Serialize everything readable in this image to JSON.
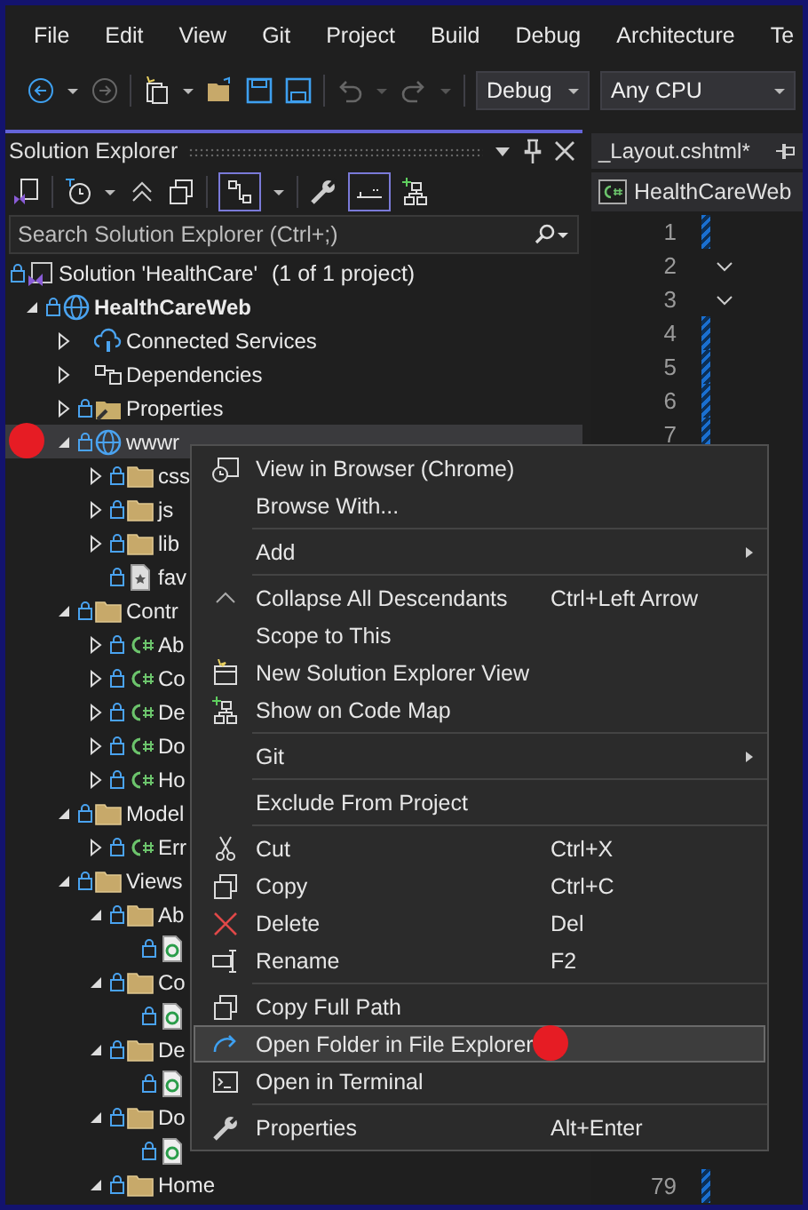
{
  "menu_bar": {
    "items": [
      "File",
      "Edit",
      "View",
      "Git",
      "Project",
      "Build",
      "Debug",
      "Architecture",
      "Te"
    ]
  },
  "toolbar": {
    "configuration": "Debug",
    "platform": "Any CPU"
  },
  "solution_explorer": {
    "title": "Solution Explorer",
    "search": {
      "placeholder": "Search Solution Explorer (Ctrl+;)"
    },
    "tree": [
      {
        "label": "Solution 'HealthCare'",
        "note": "(1 of 1 project)",
        "kind": "solution",
        "locked": true,
        "children": [
          {
            "label": "HealthCareWeb",
            "kind": "project",
            "locked": true,
            "bold": true,
            "expanded": true,
            "children": [
              {
                "label": "Connected Services",
                "kind": "connected",
                "locked": false,
                "expanded": false
              },
              {
                "label": "Dependencies",
                "kind": "dependencies",
                "locked": false,
                "expanded": false
              },
              {
                "label": "Properties",
                "kind": "properties",
                "locked": true,
                "expanded": false
              },
              {
                "label": "wwwr",
                "kind": "web",
                "locked": true,
                "expanded": true,
                "selected": true,
                "marker": true,
                "children": [
                  {
                    "label": "css",
                    "kind": "folder",
                    "locked": true,
                    "expanded": false
                  },
                  {
                    "label": "js",
                    "kind": "folder",
                    "locked": true,
                    "expanded": false
                  },
                  {
                    "label": "lib",
                    "kind": "folder",
                    "locked": true,
                    "expanded": false
                  },
                  {
                    "label": "fav",
                    "kind": "file",
                    "locked": true
                  }
                ]
              },
              {
                "label": "Contr",
                "kind": "folder",
                "locked": true,
                "expanded": true,
                "children": [
                  {
                    "label": "Ab",
                    "kind": "csharp",
                    "locked": true,
                    "expanded": false
                  },
                  {
                    "label": "Co",
                    "kind": "csharp",
                    "locked": true,
                    "expanded": false
                  },
                  {
                    "label": "De",
                    "kind": "csharp",
                    "locked": true,
                    "expanded": false
                  },
                  {
                    "label": "Do",
                    "kind": "csharp",
                    "locked": true,
                    "expanded": false
                  },
                  {
                    "label": "Ho",
                    "kind": "csharp",
                    "locked": true,
                    "expanded": false
                  }
                ]
              },
              {
                "label": "Model",
                "kind": "folder",
                "locked": true,
                "expanded": true,
                "children": [
                  {
                    "label": "Err",
                    "kind": "csharp",
                    "locked": true,
                    "expanded": false
                  }
                ]
              },
              {
                "label": "Views",
                "kind": "folder",
                "locked": true,
                "expanded": true,
                "children": [
                  {
                    "label": "Ab",
                    "kind": "folder",
                    "locked": true,
                    "expanded": true,
                    "children": [
                      {
                        "kind": "razor",
                        "locked": true
                      }
                    ]
                  },
                  {
                    "label": "Co",
                    "kind": "folder",
                    "locked": true,
                    "expanded": true,
                    "children": [
                      {
                        "kind": "razor",
                        "locked": true
                      }
                    ]
                  },
                  {
                    "label": "De",
                    "kind": "folder",
                    "locked": true,
                    "expanded": true,
                    "children": [
                      {
                        "kind": "razor",
                        "locked": true
                      }
                    ]
                  },
                  {
                    "label": "Do",
                    "kind": "folder",
                    "locked": true,
                    "expanded": true,
                    "children": [
                      {
                        "kind": "razor",
                        "locked": true
                      }
                    ]
                  },
                  {
                    "label": "Home",
                    "kind": "folder",
                    "locked": true,
                    "expanded": true
                  }
                ]
              }
            ]
          }
        ]
      }
    ]
  },
  "editor": {
    "tab": {
      "label": "_Layout.cshtml*"
    },
    "navigation": "HealthCareWeb",
    "lines_top": [
      {
        "number": "1",
        "fold": false,
        "changed": true
      },
      {
        "number": "2",
        "fold": true,
        "changed": false
      },
      {
        "number": "3",
        "fold": true,
        "changed": false
      },
      {
        "number": "4",
        "fold": false,
        "changed": true
      },
      {
        "number": "5",
        "fold": false,
        "changed": true
      },
      {
        "number": "6",
        "fold": false,
        "changed": true
      },
      {
        "number": "7",
        "fold": false,
        "changed": true
      }
    ],
    "lines_bottom": [
      {
        "number": "79",
        "fold": false,
        "changed": true
      }
    ]
  },
  "context_menu": {
    "groups": [
      [
        {
          "kind": "browser",
          "label": "View in Browser (Chrome)"
        },
        {
          "label": "Browse With..."
        }
      ],
      [
        {
          "label": "Add",
          "submenu": true
        }
      ],
      [
        {
          "kind": "collapse",
          "label": "Collapse All Descendants",
          "shortcut": "Ctrl+Left Arrow"
        },
        {
          "label": "Scope to This"
        },
        {
          "kind": "new-view",
          "label": "New Solution Explorer View"
        },
        {
          "kind": "code-map",
          "label": "Show on Code Map"
        }
      ],
      [
        {
          "label": "Git",
          "submenu": true
        }
      ],
      [
        {
          "label": "Exclude From Project"
        }
      ],
      [
        {
          "kind": "cut",
          "label": "Cut",
          "shortcut": "Ctrl+X"
        },
        {
          "kind": "copy",
          "label": "Copy",
          "shortcut": "Ctrl+C"
        },
        {
          "kind": "delete",
          "label": "Delete",
          "shortcut": "Del"
        },
        {
          "kind": "rename",
          "label": "Rename",
          "shortcut": "F2"
        }
      ],
      [
        {
          "kind": "copy",
          "label": "Copy Full Path"
        },
        {
          "kind": "open-folder",
          "label": "Open Folder in File Explorer",
          "selected": true,
          "marker": true
        },
        {
          "kind": "terminal",
          "label": "Open in Terminal"
        }
      ],
      [
        {
          "kind": "wrench",
          "label": "Properties",
          "shortcut": "Alt+Enter"
        }
      ]
    ]
  }
}
